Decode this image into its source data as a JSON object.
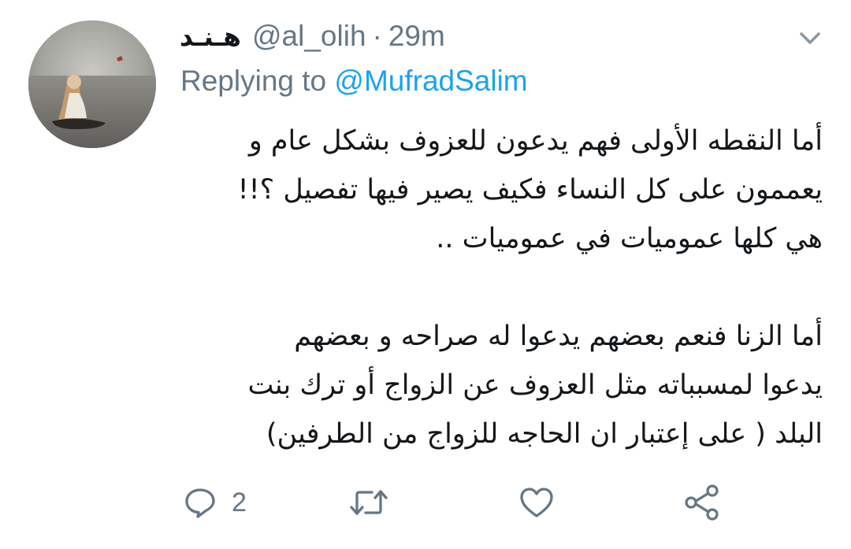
{
  "tweet": {
    "display_name": "هـنـد",
    "handle": "@al_olih",
    "separator": "·",
    "time": "29m",
    "replying_prefix": "Replying to",
    "replying_to": "@MufradSalim",
    "lines": [
      "أما النقطه الأولى فهم يدعون للعزوف بشكل عام و",
      "يعممون على كل النساء فكيف يصير فيها تفصيل ؟!!",
      "هي كلها عموميات في عموميات ..",
      "",
      "أما الزنا فنعم بعضهم يدعوا له صراحه و بعضهم",
      "يدعوا لمسبباته مثل العزوف عن الزواج أو ترك بنت",
      "البلد ( على إعتبار ان الحاجه للزواج من الطرفين)"
    ]
  },
  "actions": {
    "reply_count": "2",
    "icons": [
      "reply-icon",
      "retweet-icon",
      "like-icon",
      "share-icon"
    ]
  },
  "colors": {
    "text": "#14171a",
    "secondary": "#657786",
    "link": "#1da1f2"
  }
}
